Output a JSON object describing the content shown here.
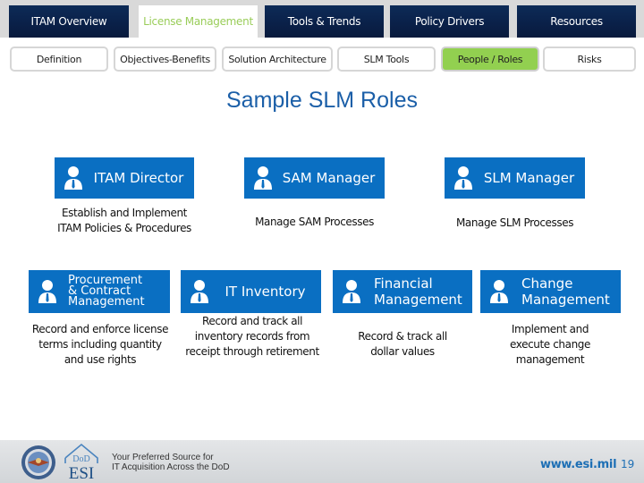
{
  "nav": {
    "main_tabs": [
      {
        "label": "ITAM Overview",
        "active": false
      },
      {
        "label": "License Management",
        "active": true
      },
      {
        "label": "Tools & Trends",
        "active": false
      },
      {
        "label": "Policy Drivers",
        "active": false
      },
      {
        "label": "Resources",
        "active": false
      }
    ],
    "sub_tabs": [
      {
        "label": "Definition",
        "active": false
      },
      {
        "label": "Objectives-Benefits",
        "active": false
      },
      {
        "label": "Solution Architecture",
        "active": false
      },
      {
        "label": "SLM Tools",
        "active": false
      },
      {
        "label": "People / Roles",
        "active": true
      },
      {
        "label": "Risks",
        "active": false
      }
    ]
  },
  "page": {
    "title": "Sample SLM Roles"
  },
  "roles": [
    {
      "title": "ITAM Director",
      "icon": "person-icon",
      "description": "Establish and Implement ITAM Policies & Procedures"
    },
    {
      "title": "SAM Manager",
      "icon": "person-icon",
      "description": "Manage SAM Processes"
    },
    {
      "title": "SLM Manager",
      "icon": "person-icon",
      "description": "Manage SLM Processes"
    },
    {
      "title_lines": [
        "Procurement",
        "& Contract",
        "Management"
      ],
      "icon": "person-icon",
      "description": "Record and enforce license terms including quantity and use rights"
    },
    {
      "title": "IT Inventory",
      "icon": "person-icon",
      "description": "Record and track all inventory records from receipt through retirement"
    },
    {
      "title_lines": [
        "Financial",
        "Management"
      ],
      "icon": "person-icon",
      "description": "Record & track all dollar values"
    },
    {
      "title_lines": [
        "Change",
        "Management"
      ],
      "icon": "person-icon",
      "description": "Implement and execute change management"
    }
  ],
  "footer": {
    "tagline_line1": "Your Preferred Source for",
    "tagline_line2": "IT Acquisition Across the DoD",
    "logo_top": "DoD",
    "logo_bottom": "ESI",
    "url": "www.esi.mil",
    "page_number": "19"
  },
  "colors": {
    "nav_dark": "#0a2048",
    "active_tab_text": "#9acd5a",
    "active_subtab": "#92d050",
    "role_box": "#0a6fc2",
    "title": "#1b5fa8",
    "url": "#1d6fb5"
  }
}
